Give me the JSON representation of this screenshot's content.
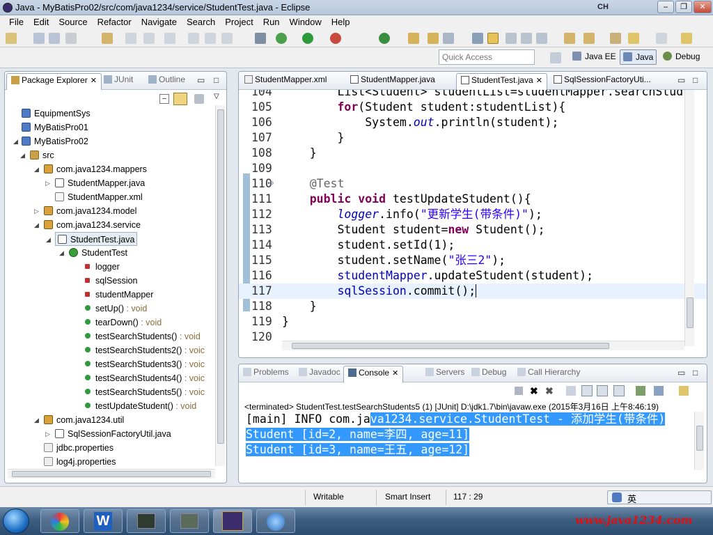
{
  "window": {
    "title": "Java - MyBatisPro02/src/com/java1234/service/StudentTest.java - Eclipse",
    "ime_indicator": "CH"
  },
  "menu": [
    "File",
    "Edit",
    "Source",
    "Refactor",
    "Navigate",
    "Search",
    "Project",
    "Run",
    "Window",
    "Help"
  ],
  "quick_access": {
    "placeholder": "Quick Access"
  },
  "perspectives": {
    "java_ee": "Java EE",
    "java": "Java",
    "debug": "Debug"
  },
  "left_panel": {
    "tabs": [
      "Package Explorer",
      "JUnit",
      "Outline"
    ],
    "tree": [
      {
        "label": "EquipmentSys",
        "icon": "project-icon",
        "expanded": false
      },
      {
        "label": "MyBatisPro01",
        "icon": "project-icon",
        "expanded": false
      },
      {
        "label": "MyBatisPro02",
        "icon": "project-icon",
        "expanded": true
      },
      {
        "label": "src",
        "icon": "source-folder-icon",
        "expanded": true
      },
      {
        "label": "com.java1234.mappers",
        "icon": "package-icon",
        "expanded": true
      },
      {
        "label": "StudentMapper.java",
        "icon": "java-file-icon",
        "expanded": false
      },
      {
        "label": "StudentMapper.xml",
        "icon": "xml-file-icon"
      },
      {
        "label": "com.java1234.model",
        "icon": "package-icon",
        "expanded": false
      },
      {
        "label": "com.java1234.service",
        "icon": "package-icon",
        "expanded": true
      },
      {
        "label": "StudentTest.java",
        "icon": "java-file-icon",
        "expanded": true,
        "selected": true
      },
      {
        "label": "StudentTest",
        "icon": "class-icon",
        "expanded": true
      },
      {
        "label": "logger",
        "icon": "static-field-icon"
      },
      {
        "label": "sqlSession",
        "icon": "field-icon"
      },
      {
        "label": "studentMapper",
        "icon": "field-icon"
      },
      {
        "label": "setUp()",
        "type": " : void",
        "icon": "method-icon"
      },
      {
        "label": "tearDown()",
        "type": " : void",
        "icon": "method-icon"
      },
      {
        "label": "testSearchStudents()",
        "type": " : void",
        "icon": "method-icon"
      },
      {
        "label": "testSearchStudents2()",
        "type": " : voic",
        "icon": "method-icon"
      },
      {
        "label": "testSearchStudents3()",
        "type": " : voic",
        "icon": "method-icon"
      },
      {
        "label": "testSearchStudents4()",
        "type": " : voic",
        "icon": "method-icon"
      },
      {
        "label": "testSearchStudents5()",
        "type": " : voic",
        "icon": "method-icon"
      },
      {
        "label": "testUpdateStudent()",
        "type": " : void",
        "icon": "method-icon"
      },
      {
        "label": "com.java1234.util",
        "icon": "package-icon",
        "expanded": true
      },
      {
        "label": "SqlSessionFactoryUtil.java",
        "icon": "java-file-icon",
        "expanded": false
      },
      {
        "label": "jdbc.properties",
        "icon": "properties-file-icon"
      },
      {
        "label": "log4j.properties",
        "icon": "properties-file-icon"
      }
    ]
  },
  "editor": {
    "tabs": [
      "StudentMapper.xml",
      "StudentMapper.java",
      "StudentTest.java",
      "SqlSessionFactoryUti..."
    ],
    "active_tab": "StudentTest.java",
    "partial_top_line": "        List<Student> studentList=studentMapper.searchStud",
    "lines": [
      {
        "n": "105",
        "indent": "        ",
        "parts": [
          [
            "kw",
            "for"
          ],
          [
            "",
            "(Student student:studentList){"
          ]
        ]
      },
      {
        "n": "106",
        "indent": "            ",
        "parts": [
          [
            "",
            "System."
          ],
          [
            "fld-ital",
            "out"
          ],
          [
            "",
            ".println(student);"
          ]
        ]
      },
      {
        "n": "107",
        "indent": "        ",
        "parts": [
          [
            "",
            "}"
          ]
        ]
      },
      {
        "n": "108",
        "indent": "    ",
        "parts": [
          [
            "",
            "}"
          ]
        ]
      },
      {
        "n": "109",
        "indent": "",
        "parts": []
      },
      {
        "n": "110",
        "indent": "    ",
        "parts": [
          [
            "ann",
            "@Test"
          ]
        ]
      },
      {
        "n": "111",
        "indent": "    ",
        "parts": [
          [
            "kw",
            "public"
          ],
          [
            "",
            " "
          ],
          [
            "kw",
            "void"
          ],
          [
            "",
            " testUpdateStudent(){"
          ]
        ]
      },
      {
        "n": "112",
        "indent": "        ",
        "parts": [
          [
            "fld-ital",
            "logger"
          ],
          [
            "",
            ".info("
          ],
          [
            "str",
            "\"更新学生(带条件)\""
          ],
          [
            "",
            ");"
          ]
        ]
      },
      {
        "n": "113",
        "indent": "        ",
        "parts": [
          [
            "",
            "Student student="
          ],
          [
            "kw",
            "new"
          ],
          [
            "",
            " Student();"
          ]
        ]
      },
      {
        "n": "114",
        "indent": "        ",
        "parts": [
          [
            "",
            "student.setId(1);"
          ]
        ]
      },
      {
        "n": "115",
        "indent": "        ",
        "parts": [
          [
            "",
            "student.setName("
          ],
          [
            "str",
            "\"张三2\""
          ],
          [
            "",
            ");"
          ]
        ]
      },
      {
        "n": "116",
        "indent": "        ",
        "parts": [
          [
            "fld",
            "studentMapper"
          ],
          [
            "",
            ".updateStudent(student);"
          ]
        ]
      },
      {
        "n": "117",
        "indent": "        ",
        "parts": [
          [
            "fld",
            "sqlSession"
          ],
          [
            "",
            ".commit();"
          ]
        ],
        "current": true
      },
      {
        "n": "118",
        "indent": "    ",
        "parts": [
          [
            "",
            "}"
          ]
        ]
      },
      {
        "n": "119",
        "indent": "",
        "parts": [
          [
            "",
            "}"
          ]
        ]
      },
      {
        "n": "120",
        "indent": "",
        "parts": []
      }
    ]
  },
  "bottom_panel": {
    "tabs": [
      "Problems",
      "Javadoc",
      "Console",
      "Servers",
      "Debug",
      "Call Hierarchy"
    ],
    "active_tab": "Console",
    "terminated_label": "<terminated> StudentTest.testSearchStudents5 (1) [JUnit] D:\\jdk1.7\\bin\\javaw.exe (2015年3月16日 上午8:46:19)",
    "output": [
      {
        "plain": "[main] INFO com.ja",
        "highlight": "va1234.service.StudentTest - 添加学生(带条件)"
      },
      {
        "plain": "",
        "highlight": "Student [id=2, name=李四, age=11]"
      },
      {
        "plain": "",
        "highlight": "Student [id=3, name=王五, age=12]"
      }
    ]
  },
  "status": {
    "mode": "Writable",
    "insert": "Smart Insert",
    "position": "117 : 29",
    "ime": "英"
  },
  "watermark": "www.java1234.com"
}
